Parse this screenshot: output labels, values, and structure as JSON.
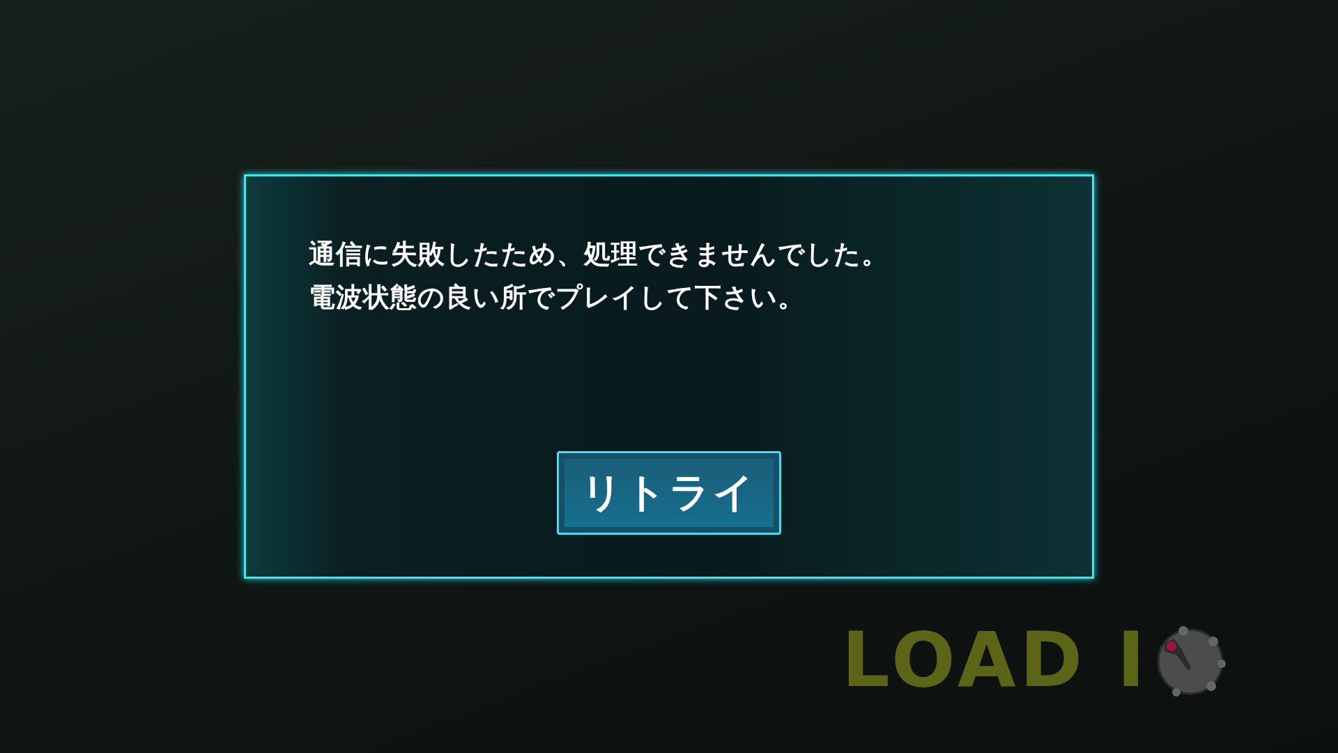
{
  "dialog": {
    "message_lines": [
      "通信に失敗したため、処理できませんでした。",
      "電波状態の良い所でプレイして下さい。"
    ],
    "button": "リトライ"
  },
  "loading_label": "LOAD I"
}
